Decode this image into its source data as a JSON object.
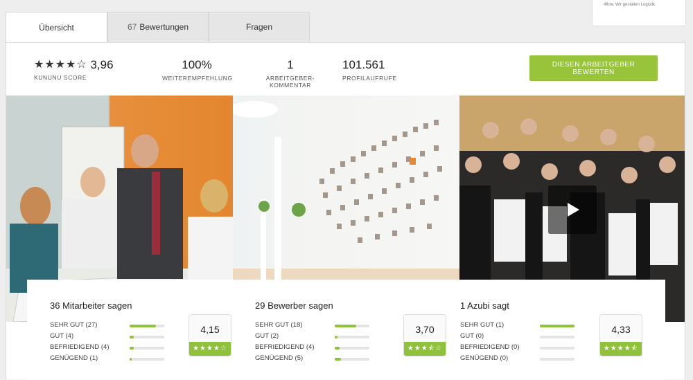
{
  "top_card": {
    "text": "4flow. Wir gestalten Logistik."
  },
  "tabs": [
    {
      "label": "Übersicht",
      "count": ""
    },
    {
      "label": "Bewertungen",
      "count": "67"
    },
    {
      "label": "Fragen",
      "count": ""
    }
  ],
  "stats": {
    "score_value": "3,96",
    "score_stars": 4,
    "score_label": "Kununu Score",
    "recommend_value": "100%",
    "recommend_label": "Weiterempfehlung",
    "comment_value": "1",
    "comment_label": "Arbeitgeber-Kommentar",
    "views_value": "101.561",
    "views_label": "Profilaufrufe"
  },
  "rate_button": "Diesen Arbeitgeber bewerten",
  "colors": {
    "accent": "#97c43a",
    "bar": "#8fc13a"
  },
  "ratings": [
    {
      "title": "36 Mitarbeiter sagen",
      "score": "4,15",
      "stars": "★★★★☆",
      "rows": [
        {
          "label": "SEHR GUT (27)",
          "fraction": 0.75
        },
        {
          "label": "GUT (4)",
          "fraction": 0.11
        },
        {
          "label": "BEFRIEDIGEND (4)",
          "fraction": 0.11
        },
        {
          "label": "GENÜGEND (1)",
          "fraction": 0.03
        }
      ]
    },
    {
      "title": "29 Bewerber sagen",
      "score": "3,70",
      "stars": "★★★⯪☆",
      "rows": [
        {
          "label": "SEHR GUT (18)",
          "fraction": 0.62
        },
        {
          "label": "GUT (2)",
          "fraction": 0.07
        },
        {
          "label": "BEFRIEDIGEND (4)",
          "fraction": 0.14
        },
        {
          "label": "GENÜGEND (5)",
          "fraction": 0.17
        }
      ]
    },
    {
      "title": "1 Azubi sagt",
      "score": "4,33",
      "stars": "★★★★⯪",
      "rows": [
        {
          "label": "SEHR GUT (1)",
          "fraction": 1.0
        },
        {
          "label": "GUT (0)",
          "fraction": 0
        },
        {
          "label": "BEFRIEDIGEND (0)",
          "fraction": 0
        },
        {
          "label": "GENÜGEND (0)",
          "fraction": 0
        }
      ]
    }
  ]
}
